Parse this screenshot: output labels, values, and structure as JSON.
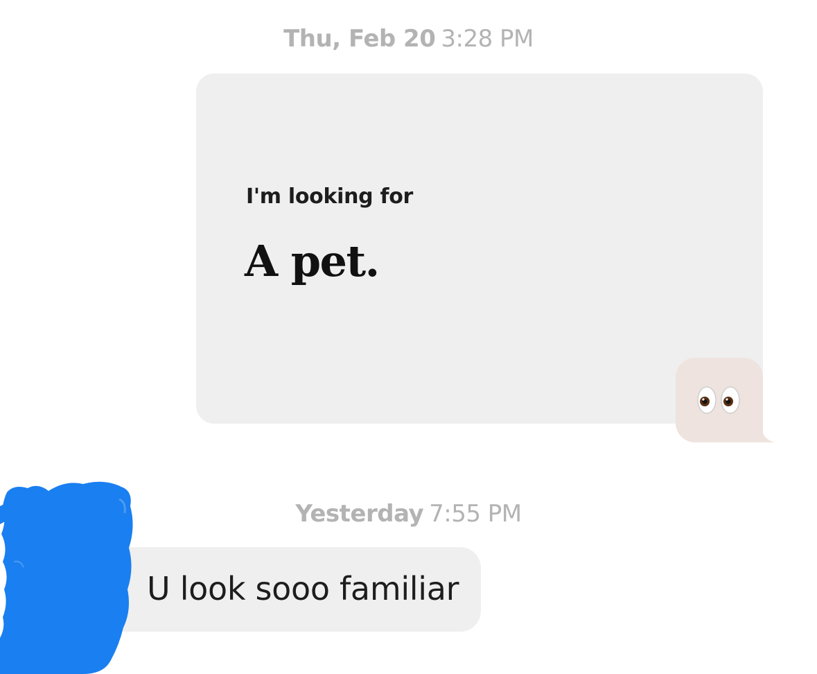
{
  "conversation": {
    "timestamp_1": {
      "day": "Thu, Feb 20",
      "time": "3:28 PM"
    },
    "prompt_card": {
      "label": "I'm looking for",
      "answer": "A pet."
    },
    "reaction_bubble": {
      "icon": "eyes-icon",
      "color": "#eee3de"
    },
    "timestamp_2": {
      "day": "Yesterday",
      "time": "7:55 PM"
    },
    "received_message": {
      "text": "U look sooo familiar"
    }
  },
  "colors": {
    "bubble_gray": "#efefef",
    "timestamp_gray": "#b3b3b3",
    "redaction_blue": "#1a7ff0"
  }
}
